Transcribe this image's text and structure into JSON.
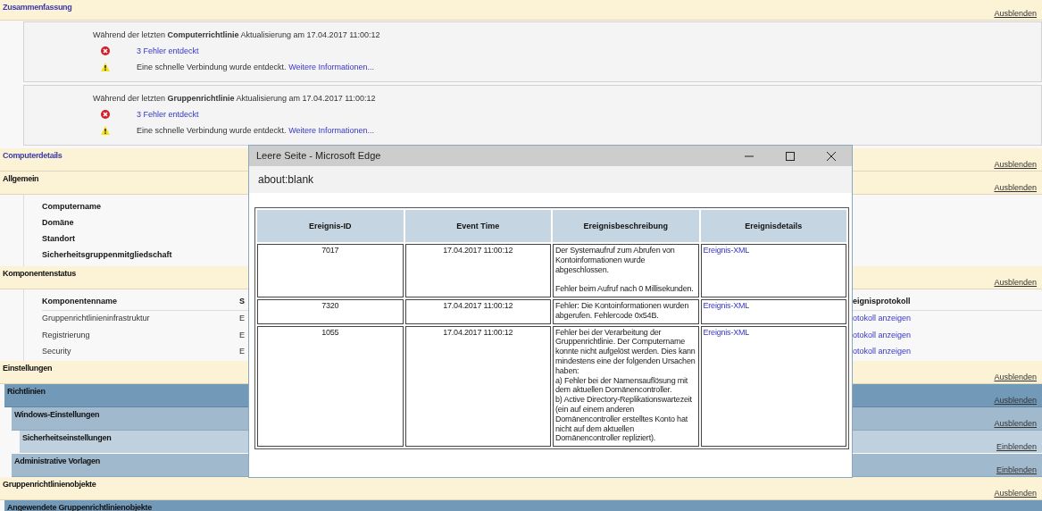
{
  "sections": [
    {
      "title": "Zusammenfassung",
      "toggle": "Ausblenden",
      "updates": [
        {
          "heading": "Während der letzten **Computerrichtlinie** Aktualisierung am 17.04.2017 11:00:12",
          "messages": [
            {
              "kind": "error",
              "text": "3 Fehler entdeckt"
            },
            {
              "kind": "warning",
              "text": "Eine schnelle Verbindung wurde entdeckt.",
              "link": "Weitere Informationen..."
            }
          ]
        },
        {
          "heading": "Während der letzten **Gruppenrichtlinie** Aktualisierung am 17.04.2017 11:00:12",
          "messages": [
            {
              "kind": "error",
              "text": "3 Fehler entdeckt"
            },
            {
              "kind": "warning",
              "text": "Eine schnelle Verbindung wurde entdeckt.",
              "link": "Weitere Informationen..."
            }
          ]
        }
      ]
    },
    {
      "title": "Computerdetails",
      "toggle": "Ausblenden",
      "children": [
        {
          "title": "Allgemein",
          "toggle": "Ausblenden",
          "fields": [
            "Computername",
            "Domäne",
            "Standort",
            "Sicherheitsgruppenmitgliedschaft"
          ]
        },
        {
          "title": "Komponentenstatus",
          "toggle": "Ausblenden",
          "table": {
            "columns": [
              "Komponentenname",
              "S",
              "eignisprotokoll"
            ],
            "rows": [
              [
                "Gruppenrichtlinieninfrastruktur",
                "E",
                "otokoll anzeigen"
              ],
              [
                "Registrierung",
                "E",
                "otokoll anzeigen"
              ],
              [
                "Security",
                "E",
                "otokoll anzeigen"
              ]
            ]
          }
        },
        {
          "title": "Einstellungen",
          "toggle": "Ausblenden",
          "children": [
            {
              "title": "Richtlinien",
              "toggle": "Ausblenden",
              "children": [
                {
                  "title": "Windows-Einstellungen",
                  "toggle": "Ausblenden",
                  "children": [
                    {
                      "title": "Sicherheitseinstellungen",
                      "toggle": "Einblenden"
                    }
                  ]
                },
                {
                  "title": "Administrative Vorlagen",
                  "toggle": "Einblenden"
                }
              ]
            }
          ]
        },
        {
          "title": "Gruppenrichtlinienobjekte",
          "toggle": "Ausblenden",
          "children": [
            {
              "title": "Angewendete Gruppenrichtlinienobjekte"
            }
          ]
        }
      ]
    }
  ],
  "browser_window": {
    "title": "Leere Seite - Microsoft Edge",
    "address": "about:blank",
    "table": {
      "columns": [
        "Ereignis-ID",
        "Event Time",
        "Ereignisbeschreibung",
        "Ereignisdetails"
      ],
      "rows": [
        {
          "id": "7017",
          "time": "17.04.2017 11:00:12",
          "description": [
            [
              "Der Systemaufruf zum Abrufen von Kontoinformationen wurde abgeschlossen."
            ],
            [
              "Fehler beim Aufruf nach 0 Millisekunden."
            ]
          ],
          "details": "Ereignis-XML"
        },
        {
          "id": "7320",
          "time": "17.04.2017 11:00:12",
          "description": [
            [
              "Fehler: Die Kontoinformationen wurden abgerufen. Fehlercode 0x54B."
            ]
          ],
          "details": "Ereignis-XML"
        },
        {
          "id": "1055",
          "time": "17.04.2017 11:00:12",
          "description": [
            [
              "Fehler bei der Verarbeitung der Gruppenrichtlinie. Der Computername konnte nicht aufgelöst werden. Dies kann mindestens eine der folgenden Ursachen haben:",
              "a) Fehler bei der Namensauflösung mit dem aktuellen Domänencontroller.",
              "b) Active Directory-Replikationswartezeit (ein auf einem anderen Domänencontroller erstelltes Konto hat nicht auf dem aktuellen Domänencontroller repliziert)."
            ]
          ],
          "details": "Ereignis-XML"
        }
      ]
    }
  }
}
